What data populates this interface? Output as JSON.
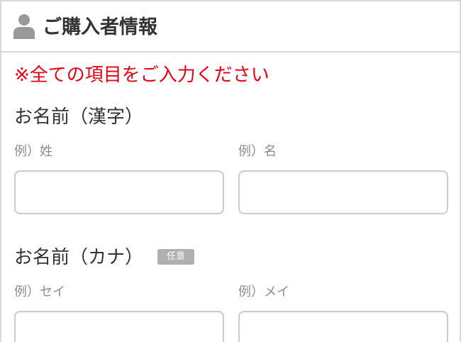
{
  "header": {
    "icon": "user-icon",
    "title": "ご購入者情報"
  },
  "notice": "※全ての項目をご入力ください",
  "name_kanji": {
    "label": "お名前（漢字）",
    "last_hint": "例）姓",
    "first_hint": "例）名",
    "last_value": "",
    "first_value": ""
  },
  "name_kana": {
    "label": "お名前（カナ）",
    "badge": "任意",
    "last_hint": "例）セイ",
    "first_hint": "例）メイ",
    "last_value": "",
    "first_value": ""
  },
  "colors": {
    "notice": "#e60012",
    "badge_bg": "#b0b0b0",
    "border": "#cccccc",
    "icon": "#999999"
  }
}
